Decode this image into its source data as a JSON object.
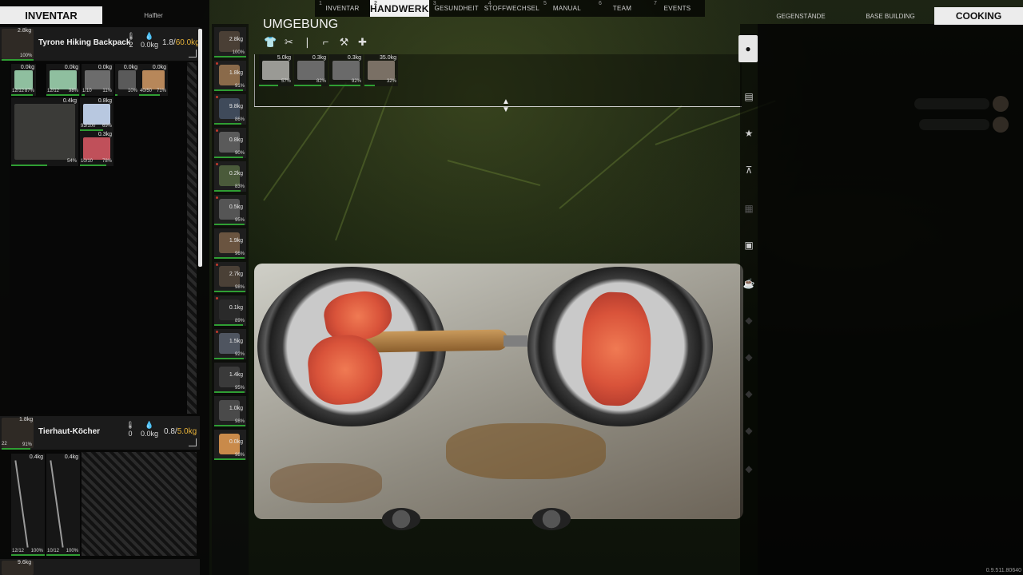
{
  "top_tabs": [
    {
      "num": "1",
      "label": "INVENTAR"
    },
    {
      "num": "2",
      "label": "HANDWERK"
    },
    {
      "num": "3",
      "label": "GESUNDHEIT"
    },
    {
      "num": "4",
      "label": "STOFFWECHSEL"
    },
    {
      "num": "5",
      "label": "MANUAL"
    },
    {
      "num": "6",
      "label": "TEAM"
    },
    {
      "num": "7",
      "label": "EVENTS"
    }
  ],
  "left_panel": {
    "tab_active": "INVENTAR",
    "tab_other": "Halfter",
    "backpack": {
      "weight": "2.8kg",
      "condition": "100%",
      "name": "Tyrone Hiking Backpack",
      "temp": "2",
      "water": "0.0kg",
      "load": "1.8/",
      "load_max": "60.0kg"
    },
    "backpack_items": [
      {
        "weight": "0.0kg",
        "count": "12/12",
        "quality": "87%",
        "q": 0.87,
        "color": "#8fbf9f"
      },
      {
        "weight": "0.0kg",
        "count": "12/12",
        "quality": "98%",
        "q": 0.98,
        "color": "#8fbf9f"
      },
      {
        "weight": "0.0kg",
        "count": "1/10",
        "quality": "11%",
        "q": 0.11,
        "color": "#6c6c6c"
      },
      {
        "weight": "0.0kg",
        "count": "",
        "quality": "10%",
        "q": 0.1,
        "color": "#5a5a5a"
      },
      {
        "weight": "0.0kg",
        "count": "40/50",
        "quality": "71%",
        "q": 0.71,
        "color": "#b7875a"
      },
      {
        "weight": "0.4kg",
        "count": "",
        "quality": "54%",
        "q": 0.54,
        "color": "#3b3b38"
      },
      {
        "weight": "0.8kg",
        "count": "93/100",
        "quality": "69%",
        "q": 0.69,
        "color": "#b8c8e0"
      },
      {
        "weight": "0.3kg",
        "count": "10/10",
        "quality": "78%",
        "q": 0.78,
        "color": "#c0505a"
      }
    ],
    "quiver": {
      "weight": "1.8kg",
      "stack": "22",
      "condition": "91%",
      "name": "Tierhaut-Köcher",
      "temp": "0",
      "water": "0.0kg",
      "load": "0.8/",
      "load_max": "5.0kg"
    },
    "quiver_items": [
      {
        "weight": "0.4kg",
        "count": "12/12",
        "quality": "100%",
        "q": 1.0
      },
      {
        "weight": "0.4kg",
        "count": "10/12",
        "quality": "100%",
        "q": 1.0
      }
    ],
    "third": {
      "weight": "9.6kg"
    }
  },
  "equipment": [
    {
      "weight": "2.8kg",
      "quality": "100%",
      "q": 1.0,
      "color": "#4a3f35",
      "warn": false
    },
    {
      "weight": "1.8kg",
      "quality": "91%",
      "q": 0.91,
      "color": "#8a6a4a",
      "warn": true
    },
    {
      "weight": "9.8kg",
      "quality": "86%",
      "q": 0.86,
      "color": "#3f4a5a",
      "warn": true
    },
    {
      "weight": "0.8kg",
      "quality": "90%",
      "q": 0.9,
      "color": "#5a5a5a",
      "warn": true
    },
    {
      "weight": "0.2kg",
      "quality": "83%",
      "q": 0.83,
      "color": "#4a5a3a",
      "warn": true
    },
    {
      "weight": "0.5kg",
      "quality": "95%",
      "q": 0.95,
      "color": "#555555",
      "warn": true
    },
    {
      "weight": "1.9kg",
      "quality": "96%",
      "q": 0.96,
      "color": "#6a5440",
      "warn": false
    },
    {
      "weight": "2.7kg",
      "quality": "98%",
      "q": 0.98,
      "color": "#4a4036",
      "warn": true
    },
    {
      "weight": "0.1kg",
      "quality": "89%",
      "q": 0.89,
      "color": "#2a2a2a",
      "warn": true
    },
    {
      "weight": "1.5kg",
      "quality": "92%",
      "q": 0.92,
      "color": "#4f5560",
      "warn": true
    },
    {
      "weight": "1.4kg",
      "quality": "95%",
      "q": 0.95,
      "color": "#3a3a3a",
      "warn": false
    },
    {
      "weight": "1.0kg",
      "quality": "98%",
      "q": 0.98,
      "color": "#4a4a4a",
      "warn": false
    },
    {
      "weight": "0.0kg",
      "quality": "98%",
      "q": 0.98,
      "color": "#c98a4a",
      "warn": false
    }
  ],
  "umgebung": {
    "title": "UMGEBUNG",
    "filter_icons": [
      "shirt-icon",
      "tools-icon",
      "bottle-icon",
      "gun-icon",
      "hammer-icon",
      "medical-cross-icon"
    ],
    "items": [
      {
        "weight": "5.0kg",
        "quality": "57%",
        "q": 0.57,
        "color": "#9a9a95"
      },
      {
        "weight": "0.3kg",
        "quality": "82%",
        "q": 0.82,
        "color": "#6a6a6a"
      },
      {
        "weight": "0.3kg",
        "quality": "92%",
        "q": 0.92,
        "color": "#6a6a6a"
      },
      {
        "weight": "35.0kg",
        "quality": "32%",
        "q": 0.32,
        "color": "#7a7065"
      }
    ]
  },
  "rail_icons": [
    "chef-hat-icon",
    "book-icon",
    "star-icon",
    "grill-icon",
    "box-icon",
    "oven-icon",
    "cup-icon"
  ],
  "right_panel": {
    "tabs": [
      "GEGENSTÄNDE",
      "BASE BUILDING",
      "COOKING"
    ],
    "active": "COOKING"
  },
  "version": "0.9.511.80640"
}
